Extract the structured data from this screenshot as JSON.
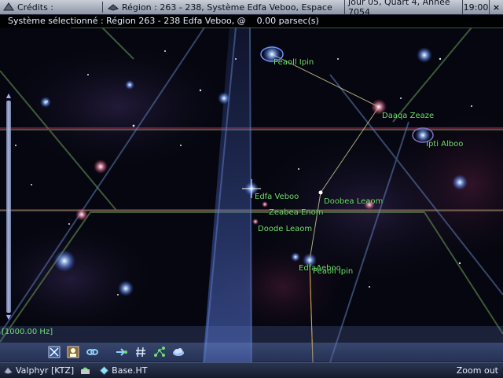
{
  "topbar": {
    "credits_label": "Crédits :",
    "region_text": "Région : 263 - 238, Système Edfa Veboo, Espace",
    "date_text": "Jour 05, Quart 4, Année 7054",
    "time_text": "19:00",
    "close_label": "×"
  },
  "selection": {
    "text": "Système sélectionné : Région 263 - 238 Edfa Veboo, @    0.00 parsec(s)"
  },
  "stars": [
    {
      "name": "Peaoll Ipin",
      "label": "Peaoll Ipin"
    },
    {
      "name": "Daaqa Zeaze",
      "label": "Daaqa Zeaze"
    },
    {
      "name": "Ipti Alboo",
      "label": "Ipti Alboo"
    },
    {
      "name": "Edfa Veboo",
      "label": "Edfa Veboo"
    },
    {
      "name": "Zeabea Enom",
      "label": "Zeabea Enom"
    },
    {
      "name": "Doobea Leaom",
      "label": "Doobea Leaom"
    },
    {
      "name": "Doode Leaom",
      "label": "Doode Leaom"
    },
    {
      "name": "Edfa Aeboo",
      "label": "EdfaAeboo"
    },
    {
      "name": "Peaoll Ipin 2",
      "label": "Peaoll Ipin"
    }
  ],
  "map": {
    "frequency": "[1000.00 Hz]"
  },
  "toolbar": {
    "icons": [
      "grid-x-icon",
      "person-icon",
      "link-icon",
      "route-icon",
      "hash-icon",
      "network-icon",
      "cloud-icon"
    ]
  },
  "statusbar": {
    "pilot": "Valphyr [KTZ]",
    "base": "Base.HT",
    "zoom_out": "Zoom out"
  },
  "colors": {
    "label_green": "#6ee06e",
    "grid_blue": "#6a86c8",
    "grid_red": "#c04060",
    "grid_green": "#6e9e5a"
  }
}
